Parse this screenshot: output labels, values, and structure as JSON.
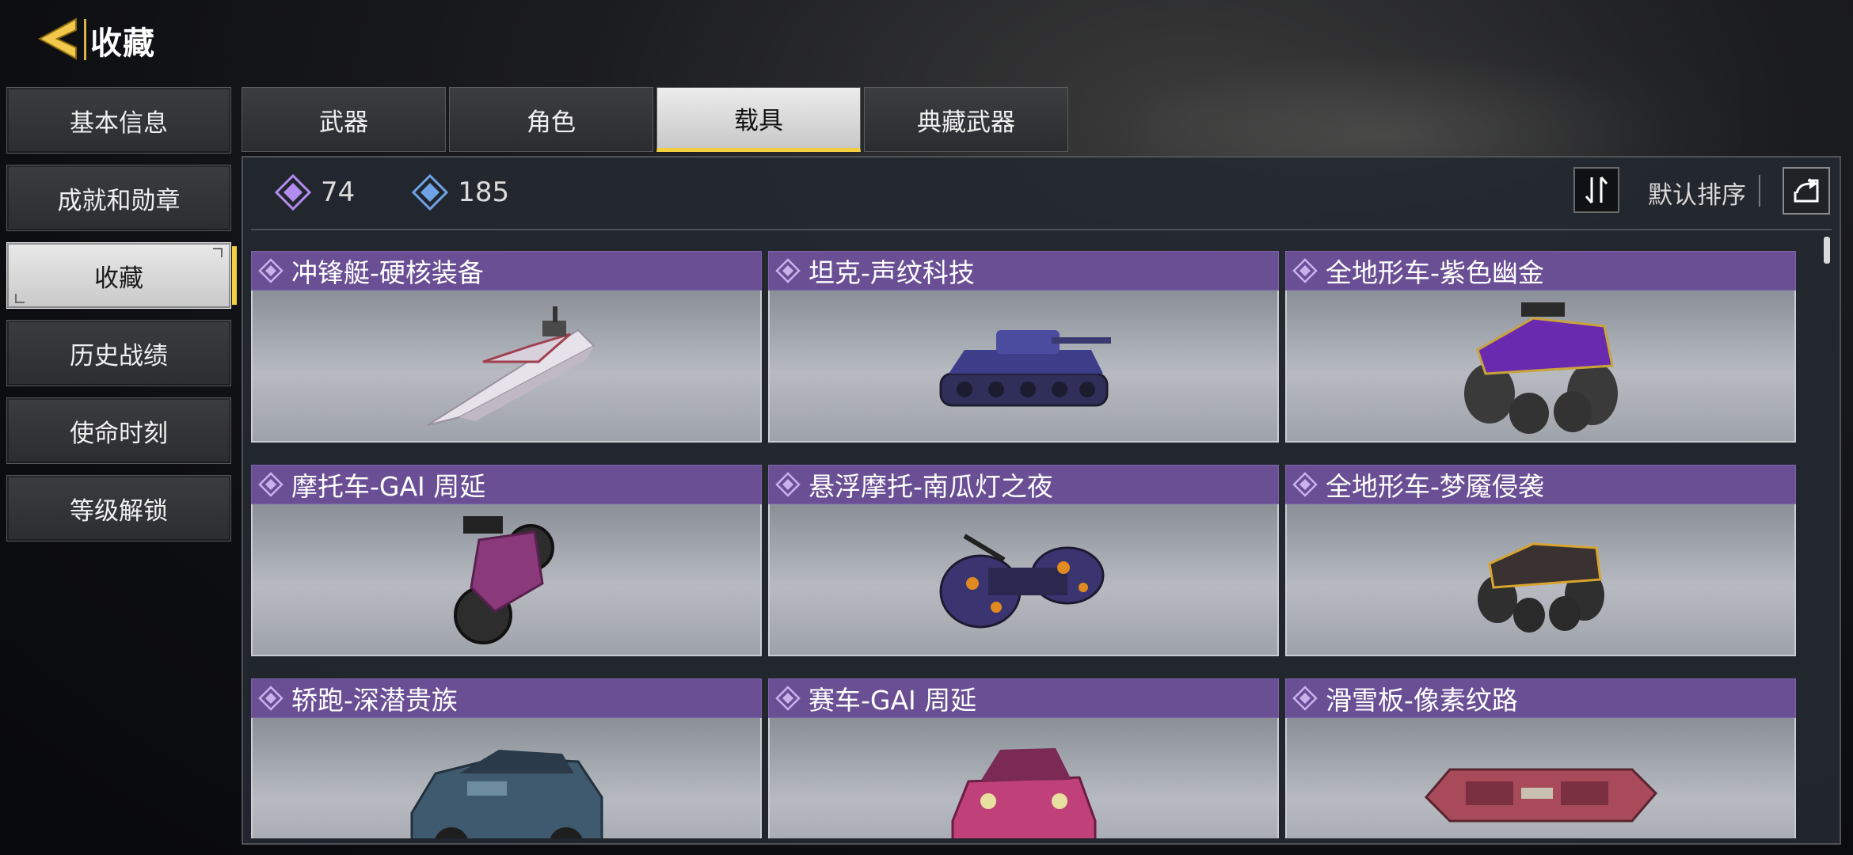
{
  "header": {
    "title": "收藏",
    "back_icon": "back-arrow-icon"
  },
  "sidebar": {
    "items": [
      {
        "label": "基本信息",
        "active": false
      },
      {
        "label": "成就和勋章",
        "active": false
      },
      {
        "label": "收藏",
        "active": true
      },
      {
        "label": "历史战绩",
        "active": false
      },
      {
        "label": "使命时刻",
        "active": false
      },
      {
        "label": "等级解锁",
        "active": false
      }
    ]
  },
  "tabs": [
    {
      "label": "武器",
      "active": false
    },
    {
      "label": "角色",
      "active": false
    },
    {
      "label": "载具",
      "active": true
    },
    {
      "label": "典藏武器",
      "active": false
    }
  ],
  "stats": {
    "legendary_count": "74",
    "epic_count": "185"
  },
  "sort": {
    "label": "默认排序"
  },
  "items": [
    {
      "name": "冲锋艇-硬核装备",
      "vehicle": "boat"
    },
    {
      "name": "坦克-声纹科技",
      "vehicle": "tank"
    },
    {
      "name": "全地形车-紫色幽金",
      "vehicle": "atv-purple"
    },
    {
      "name": "摩托车-GAI 周延",
      "vehicle": "motorcycle"
    },
    {
      "name": "悬浮摩托-南瓜灯之夜",
      "vehicle": "hoverbike"
    },
    {
      "name": "全地形车-梦魇侵袭",
      "vehicle": "atv-dark"
    },
    {
      "name": "轿跑-深潜贵族",
      "vehicle": "coupe"
    },
    {
      "name": "赛车-GAI 周延",
      "vehicle": "racecar"
    },
    {
      "name": "滑雪板-像素纹路",
      "vehicle": "snowboard"
    }
  ],
  "colors": {
    "accent": "#f4cf3f",
    "rarity_header": "#6a4f95",
    "legendary_icon": "#b48cf0",
    "epic_icon": "#6fa3e6"
  }
}
